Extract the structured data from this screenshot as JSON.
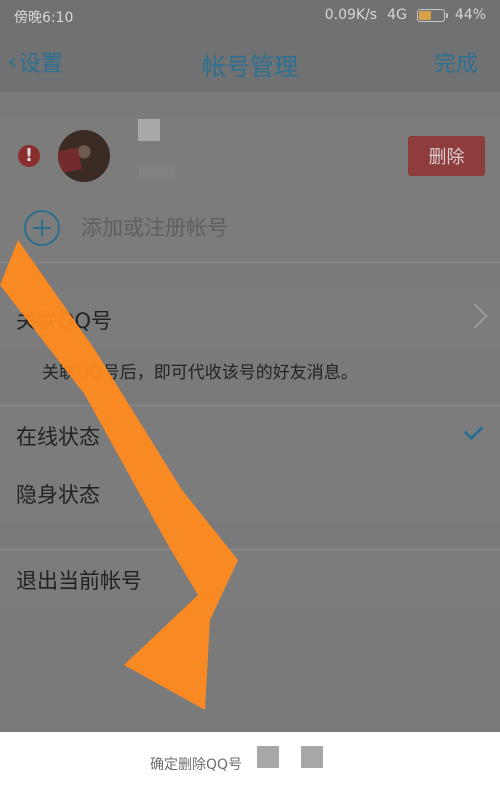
{
  "status": {
    "time": "傍晚6:10",
    "network": "0.09K/s",
    "carrier": "4G",
    "battery": "44%"
  },
  "nav": {
    "back": "设置",
    "title": "帐号管理",
    "done": "完成"
  },
  "account": {
    "delete": "删除"
  },
  "add_account": "添加或注册帐号",
  "assoc": {
    "label": "关联QQ号",
    "desc": "关联QQ号后，即可代收该号的好友消息。"
  },
  "online": "在线状态",
  "stealth": "隐身状态",
  "logout": "退出当前帐号",
  "sheet": {
    "confirm": "确定删除QQ号"
  }
}
